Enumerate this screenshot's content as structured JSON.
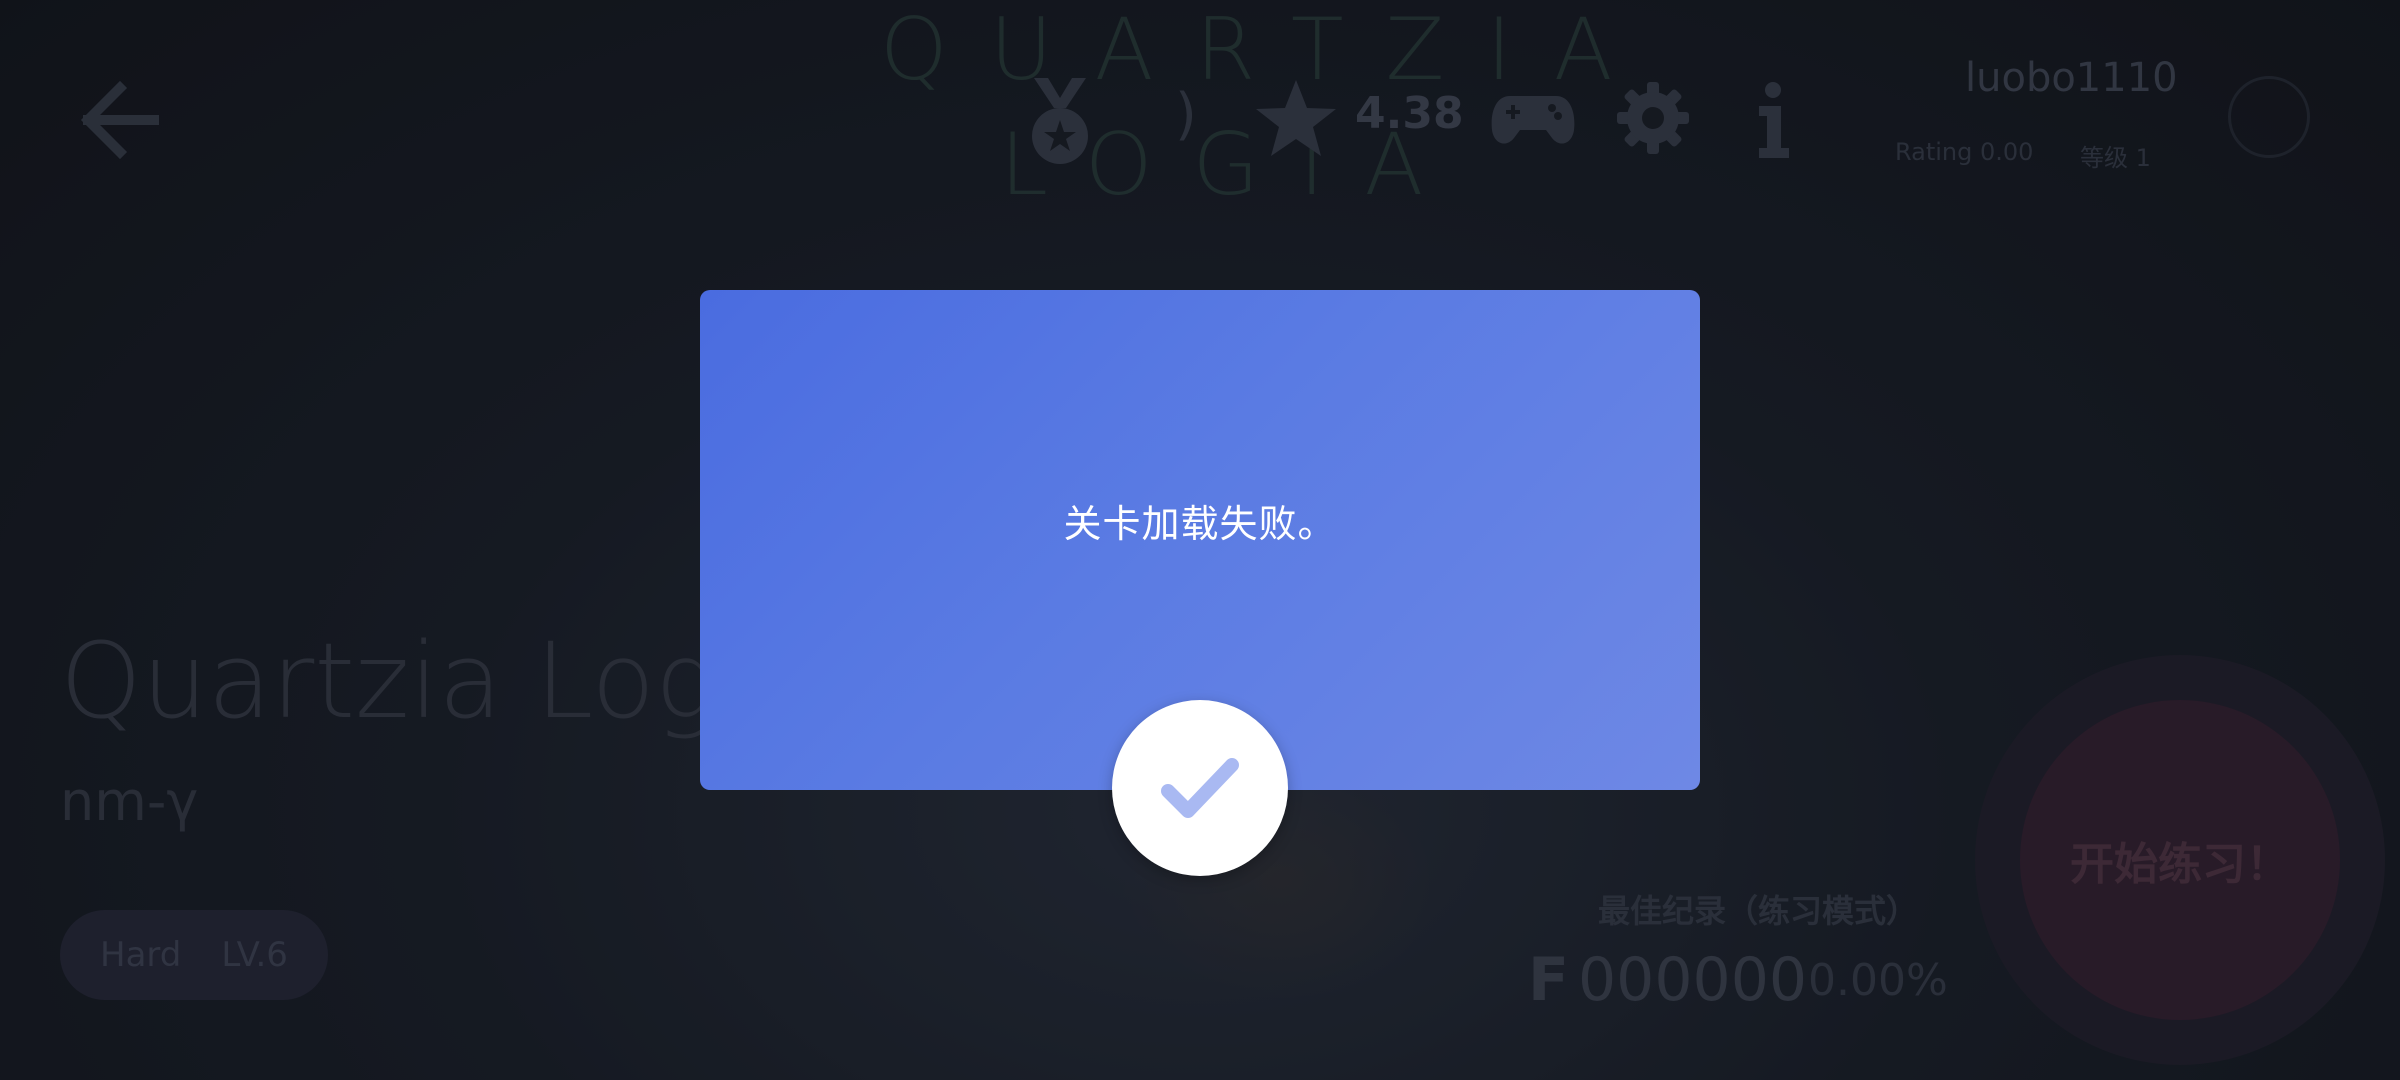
{
  "header": {
    "logo_line1": "QUARTZIA",
    "logo_line2": "LOGIA",
    "paren_mark": ")",
    "rating_value": "4.38"
  },
  "user": {
    "username": "luobo1110",
    "rating_text": "Rating 0.00",
    "level_text": "等级 1"
  },
  "song": {
    "title": "Quartzia Logia",
    "artist": "nm-γ",
    "difficulty": "Hard",
    "level": "LV.6"
  },
  "best_record": {
    "label": "最佳纪录（练习模式）",
    "rank": "F",
    "score": "000000",
    "accuracy": "0.00%"
  },
  "start_button": {
    "label": "开始练习！"
  },
  "dialog": {
    "message": "关卡加载失败。"
  },
  "colors": {
    "dialog_gradient_start": "#4a6ce0",
    "dialog_gradient_end": "#6e88e5",
    "confirm_check": "#a9b9f2",
    "background": "#1a1d24"
  },
  "icons": {
    "back": "arrow-left-icon",
    "medal": "medal-icon",
    "star": "star-icon",
    "gamepad": "gamepad-icon",
    "settings": "gear-icon",
    "info": "info-icon",
    "confirm": "check-icon"
  }
}
